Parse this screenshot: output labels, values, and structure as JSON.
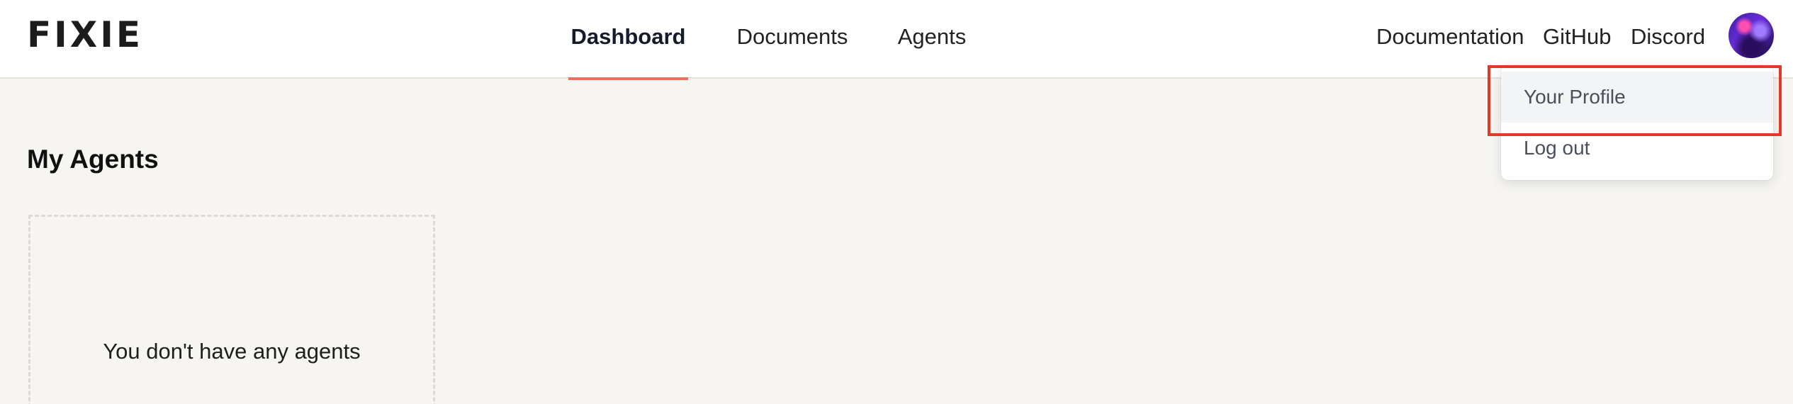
{
  "header": {
    "logo": "FIXIE",
    "tabs": [
      {
        "label": "Dashboard",
        "active": true
      },
      {
        "label": "Documents",
        "active": false
      },
      {
        "label": "Agents",
        "active": false
      }
    ],
    "links": [
      "Documentation",
      "GitHub",
      "Discord"
    ],
    "avatar_icon": "user-avatar"
  },
  "main": {
    "title": "My Agents",
    "empty_state": "You don't have any agents"
  },
  "user_menu": {
    "items": [
      "Your Profile",
      "Log out"
    ],
    "highlighted": "Your Profile"
  },
  "colors": {
    "active_tab_underline": "#e8735d",
    "annotation_box": "#e03a27",
    "page_background": "#f6f5f2"
  }
}
